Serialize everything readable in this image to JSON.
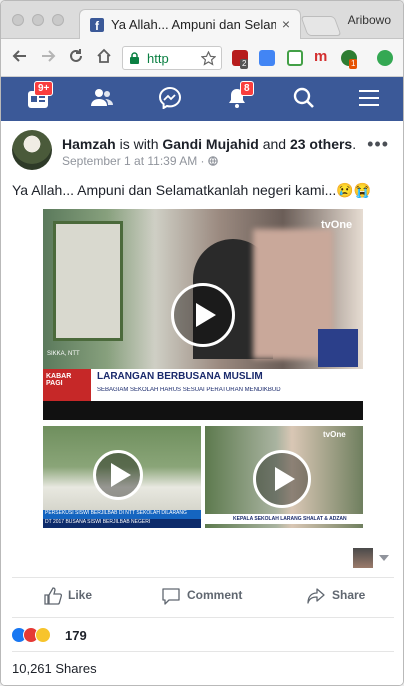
{
  "browser": {
    "tab_title": "Ya Allah... Ampuni dan Selamat",
    "tab_favicon": "f",
    "tab_close": "×",
    "profile_name": "Aribowo",
    "url_text": "http",
    "extension_badge_1": "2",
    "extension_badge_2": "1"
  },
  "fbnav": {
    "home_badge": "9+",
    "notifications_badge": "8"
  },
  "post": {
    "author": "Hamzah",
    "with_text": "is with",
    "tagged": "Gandi Mujahid",
    "and_text": "and",
    "others": "23 others",
    "period": ".",
    "date": "September 1 at 11:39 AM",
    "separator": "·",
    "more": "•••",
    "text": "Ya Allah... Ampuni dan Selamatkanlah negeri kami...😢😭",
    "video_main": {
      "channel": "tvOne",
      "brand": "KABAR PAGI",
      "location": "SIKKA, NTT",
      "headline": "LARANGAN BERBUSANA MUSLIM",
      "subheadline": "SEBAGIAM SEKOLAH HARUS SESUAI PERATURAN MENDIKBUD"
    },
    "video_left": {
      "caption": "PERSEKUSI SISWI BERJILBAB DI NTT SEKOLAH DILARANG",
      "caption2": "DT 2017 BUSANA SISWI BERJILBAB NEGERI"
    },
    "video_right": {
      "channel": "tvOne",
      "caption": "KEPALA SEKOLAH LARANG SHALAT & ADZAN"
    },
    "actions": {
      "like": "Like",
      "comment": "Comment",
      "share": "Share"
    },
    "reaction_count": "179",
    "shares": "10,261 Shares"
  },
  "colors": {
    "facebook_blue": "#3b5998",
    "notification_red": "#fa3e3e",
    "url_green": "#0b8043"
  }
}
